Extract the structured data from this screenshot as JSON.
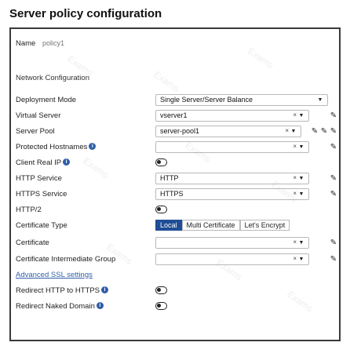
{
  "title": "Server policy configuration",
  "name": {
    "label": "Name",
    "placeholder": "policy1"
  },
  "network_heading": "Network Configuration",
  "deployment_mode": {
    "label": "Deployment Mode",
    "value": "Single Server/Server Balance"
  },
  "virtual_server": {
    "label": "Virtual Server",
    "value": "vserver1"
  },
  "server_pool": {
    "label": "Server Pool",
    "value": "server-pool1"
  },
  "protected_hostnames": {
    "label": "Protected Hostnames",
    "value": ""
  },
  "client_real_ip": {
    "label": "Client Real IP",
    "enabled": false
  },
  "http_service": {
    "label": "HTTP Service",
    "value": "HTTP"
  },
  "https_service": {
    "label": "HTTPS Service",
    "value": "HTTPS"
  },
  "http2": {
    "label": "HTTP/2",
    "enabled": false
  },
  "certificate_type": {
    "label": "Certificate Type",
    "options": [
      "Local",
      "Multi Certificate",
      "Let's Encrypt"
    ],
    "selected": "Local"
  },
  "certificate": {
    "label": "Certificate",
    "value": ""
  },
  "intermediate_group": {
    "label": "Certificate Intermediate Group",
    "value": ""
  },
  "advanced_ssl": "Advanced SSL settings",
  "redirect_http": {
    "label": "Redirect HTTP to HTTPS",
    "enabled": false
  },
  "redirect_naked": {
    "label": "Redirect Naked Domain",
    "enabled": false
  },
  "watermark_text": "Exams",
  "colors": {
    "accent": "#1f4e96",
    "info": "#2f5fa8",
    "border": "#3a3a3a"
  }
}
